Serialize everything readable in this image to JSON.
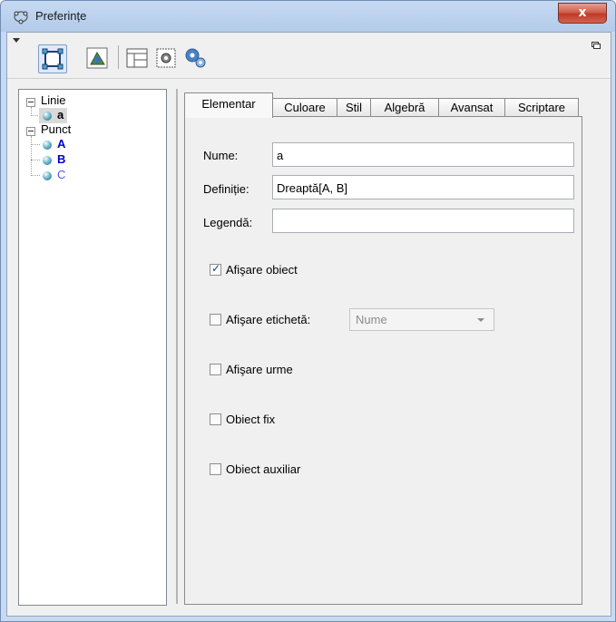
{
  "window": {
    "title": "Preferințe",
    "close_symbol": "x"
  },
  "toolbar": {
    "buttons": [
      {
        "name": "object-properties-icon",
        "selected": true
      },
      {
        "name": "graphics-icon",
        "selected": false
      },
      {
        "name": "layout-icon",
        "selected": false
      },
      {
        "name": "defaults-icon",
        "selected": false
      },
      {
        "name": "advanced-settings-icon",
        "selected": false
      }
    ]
  },
  "tree": {
    "groups": [
      {
        "label": "Linie",
        "items": [
          {
            "label": "a",
            "color": "#000000",
            "selected": true
          }
        ]
      },
      {
        "label": "Punct",
        "items": [
          {
            "label": "A",
            "color": "#0000cc",
            "selected": false
          },
          {
            "label": "B",
            "color": "#0000cc",
            "selected": false
          },
          {
            "label": "C",
            "color": "#5555e0",
            "selected": false
          }
        ]
      }
    ]
  },
  "tabs": [
    "Elementar",
    "Culoare",
    "Stil",
    "Algebră",
    "Avansat",
    "Scriptare"
  ],
  "active_tab": "Elementar",
  "form": {
    "name_label": "Nume:",
    "name_value": "a",
    "definition_label": "Definiție:",
    "definition_value": "Dreaptă[A, B]",
    "caption_label": "Legendă:",
    "caption_value": ""
  },
  "options": {
    "show_object": {
      "label": "Afişare obiect",
      "checked": true
    },
    "show_label": {
      "label": "Afişare etichetă:",
      "checked": false,
      "select_value": "Nume"
    },
    "show_trace": {
      "label": "Afişare urme",
      "checked": false
    },
    "fix_object": {
      "label": "Obiect fix",
      "checked": false
    },
    "auxiliary_object": {
      "label": "Obiect auxiliar",
      "checked": false
    }
  }
}
